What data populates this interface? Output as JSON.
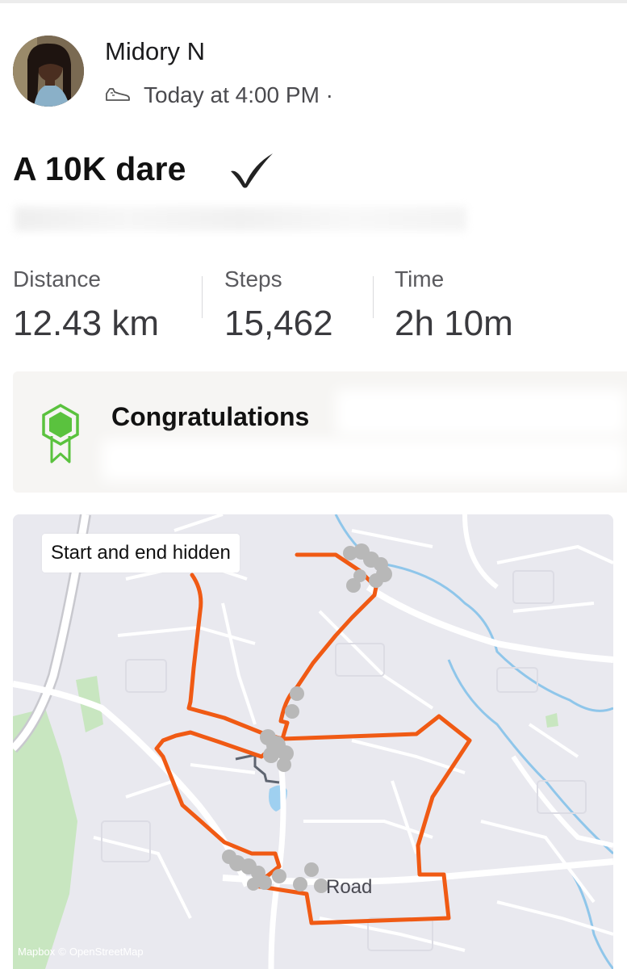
{
  "header": {
    "athlete_name": "Midory N",
    "activity_icon": "shoe-icon",
    "timestamp": "Today at 4:00 PM ·"
  },
  "activity": {
    "title": "A 10K dare",
    "title_icon": "checkmark-icon"
  },
  "stats": [
    {
      "label": "Distance",
      "value": "12.43 km"
    },
    {
      "label": "Steps",
      "value": "15,462"
    },
    {
      "label": "Time",
      "value": "2h 10m"
    }
  ],
  "achievement": {
    "icon": "badge-icon",
    "title": "Congratulations",
    "accent_color": "#5ac23e"
  },
  "map": {
    "privacy_label": "Start and end hidden",
    "road_label": "Road",
    "attribution": [
      "Mapbox",
      "©",
      "OpenStreetMap"
    ],
    "route_color": "#f05a14",
    "hidden_marker_color": "#b8b8b8"
  }
}
